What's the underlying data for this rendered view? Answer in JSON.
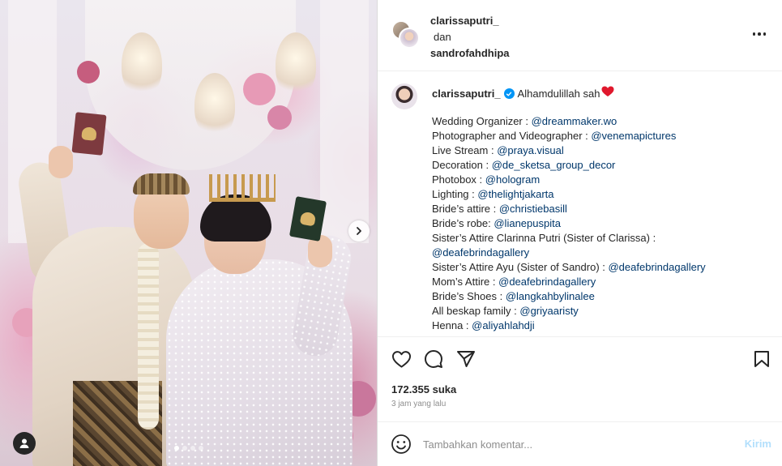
{
  "post": {
    "owner": "clarissaputri_",
    "conjunction": "dan",
    "coauthor": "sandrofahdhipa"
  },
  "caption": {
    "username": "clarissaputri_",
    "headline": "Alhamdulillah sah",
    "heart_emoji": "❤️",
    "lines": [
      {
        "label": "Wedding Organizer : ",
        "mention": "@dreammaker.wo"
      },
      {
        "label": "Photographer and Videographer : ",
        "mention": "@venemapictures"
      },
      {
        "label": "Live Stream : ",
        "mention": "@praya.visual"
      },
      {
        "label": "Decoration : ",
        "mention": "@de_sketsa_group_decor"
      },
      {
        "label": "Photobox : ",
        "mention": "@hologram"
      },
      {
        "label": "Lighting : ",
        "mention": "@thelightjakarta"
      },
      {
        "label": "Bride’s attire : ",
        "mention": "@christiebasill"
      },
      {
        "label": "Bride’s robe: ",
        "mention": "@lianepuspita"
      },
      {
        "label": "Sister’s Attire Clarinna Putri (Sister of Clarissa) :",
        "mention": ""
      },
      {
        "label": "",
        "mention": "@deafebrindagallery"
      },
      {
        "label": "Sister’s Attire Ayu (Sister of Sandro) : ",
        "mention": "@deafebrindagallery"
      },
      {
        "label": "Mom’s Attire : ",
        "mention": "@deafebrindagallery"
      },
      {
        "label": "Bride’s Shoes : ",
        "mention": "@langkahbylinalee"
      },
      {
        "label": "All beskap family : ",
        "mention": "@griyaaristy"
      },
      {
        "label": "Henna : ",
        "mention": "@aliyahlahdji"
      }
    ]
  },
  "stats": {
    "likes": "172.355 suka",
    "time_ago": "3 jam yang lalu"
  },
  "comment": {
    "placeholder": "Tambahkan komentar...",
    "post_label": "Kirim"
  },
  "carousel": {
    "slide_count": 4,
    "active_index": 0
  },
  "colors": {
    "mention": "#00376b",
    "verified": "#0095f6",
    "post_disabled": "#b2dffc",
    "muted": "#8e8e8e"
  },
  "icons": [
    "heart-icon",
    "comment-icon",
    "share-icon",
    "bookmark-icon",
    "emoji-icon",
    "more-icon",
    "verified-icon",
    "chevron-right-icon",
    "user-tag-icon"
  ]
}
